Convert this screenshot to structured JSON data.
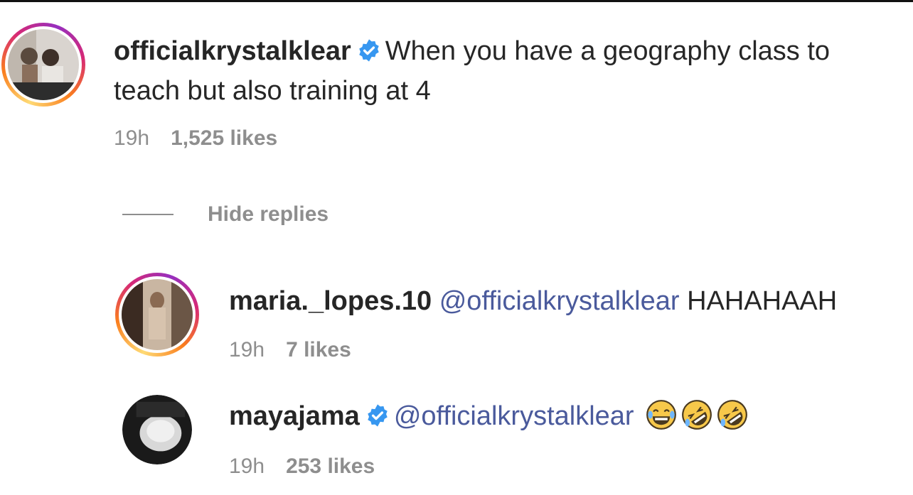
{
  "main_comment": {
    "username": "officialkrystalklear",
    "verified": true,
    "text": "When you have a geography class to teach but also training at 4",
    "time": "19h",
    "likes": "1,525 likes"
  },
  "hide_replies_label": "Hide replies",
  "replies": [
    {
      "username": "maria._lopes.10",
      "verified": false,
      "mention": "@officialkrystalklear",
      "text": "HAHAHAAH",
      "time": "19h",
      "likes": "7 likes"
    },
    {
      "username": "mayajama",
      "verified": true,
      "mention": "@officialkrystalklear",
      "emojis": [
        "face-with-tears-of-joy",
        "rolling-on-floor-laughing",
        "rolling-on-floor-laughing"
      ],
      "time": "19h",
      "likes": "253 likes"
    }
  ],
  "colors": {
    "text": "#262626",
    "meta": "#8e8e8e",
    "mention": "#4a5a9c",
    "verified": "#3797f0"
  }
}
